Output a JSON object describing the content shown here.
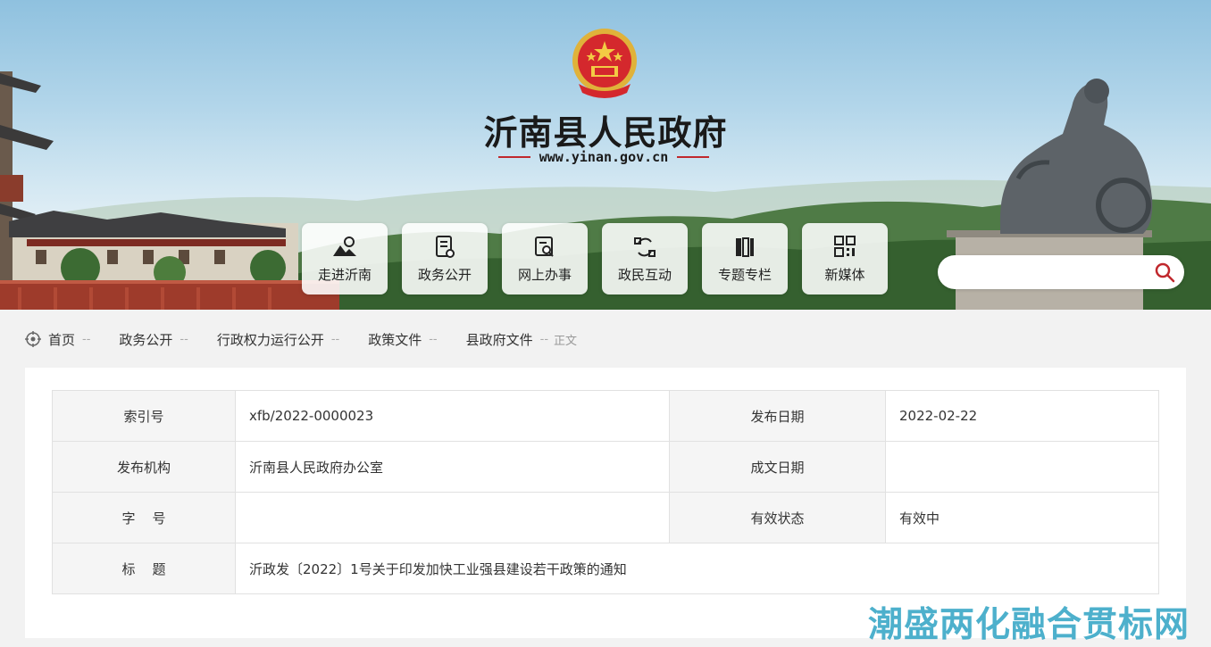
{
  "site": {
    "title": "沂南县人民政府",
    "url": "www.yinan.gov.cn"
  },
  "nav": [
    {
      "label": "走进沂南",
      "icon": "landscape-icon"
    },
    {
      "label": "政务公开",
      "icon": "document-icon"
    },
    {
      "label": "网上办事",
      "icon": "search-document-icon"
    },
    {
      "label": "政民互动",
      "icon": "exchange-icon"
    },
    {
      "label": "专题专栏",
      "icon": "books-icon"
    },
    {
      "label": "新媒体",
      "icon": "qr-code-icon"
    }
  ],
  "search": {
    "placeholder": ""
  },
  "breadcrumb": {
    "items": [
      "首页",
      "政务公开",
      "行政权力运行公开",
      "政策文件",
      "县政府文件"
    ],
    "separator": "--",
    "current": "正文"
  },
  "meta": {
    "index_label": "索引号",
    "index_value": "xfb/2022-0000023",
    "publish_date_label": "发布日期",
    "publish_date_value": "2022-02-22",
    "org_label": "发布机构",
    "org_value": "沂南县人民政府办公室",
    "created_date_label": "成文日期",
    "created_date_value": "",
    "doc_no_label": "字    号",
    "doc_no_value": "",
    "status_label": "有效状态",
    "status_value": "有效中",
    "title_label": "标    题",
    "title_value": "沂政发〔2022〕1号关于印发加快工业强县建设若干政策的通知"
  },
  "watermark": "潮盛两化融合贯标网",
  "colors": {
    "accent_red": "#c0282d",
    "watermark": "#3aa8c7",
    "table_header_bg": "#f5f5f5"
  }
}
